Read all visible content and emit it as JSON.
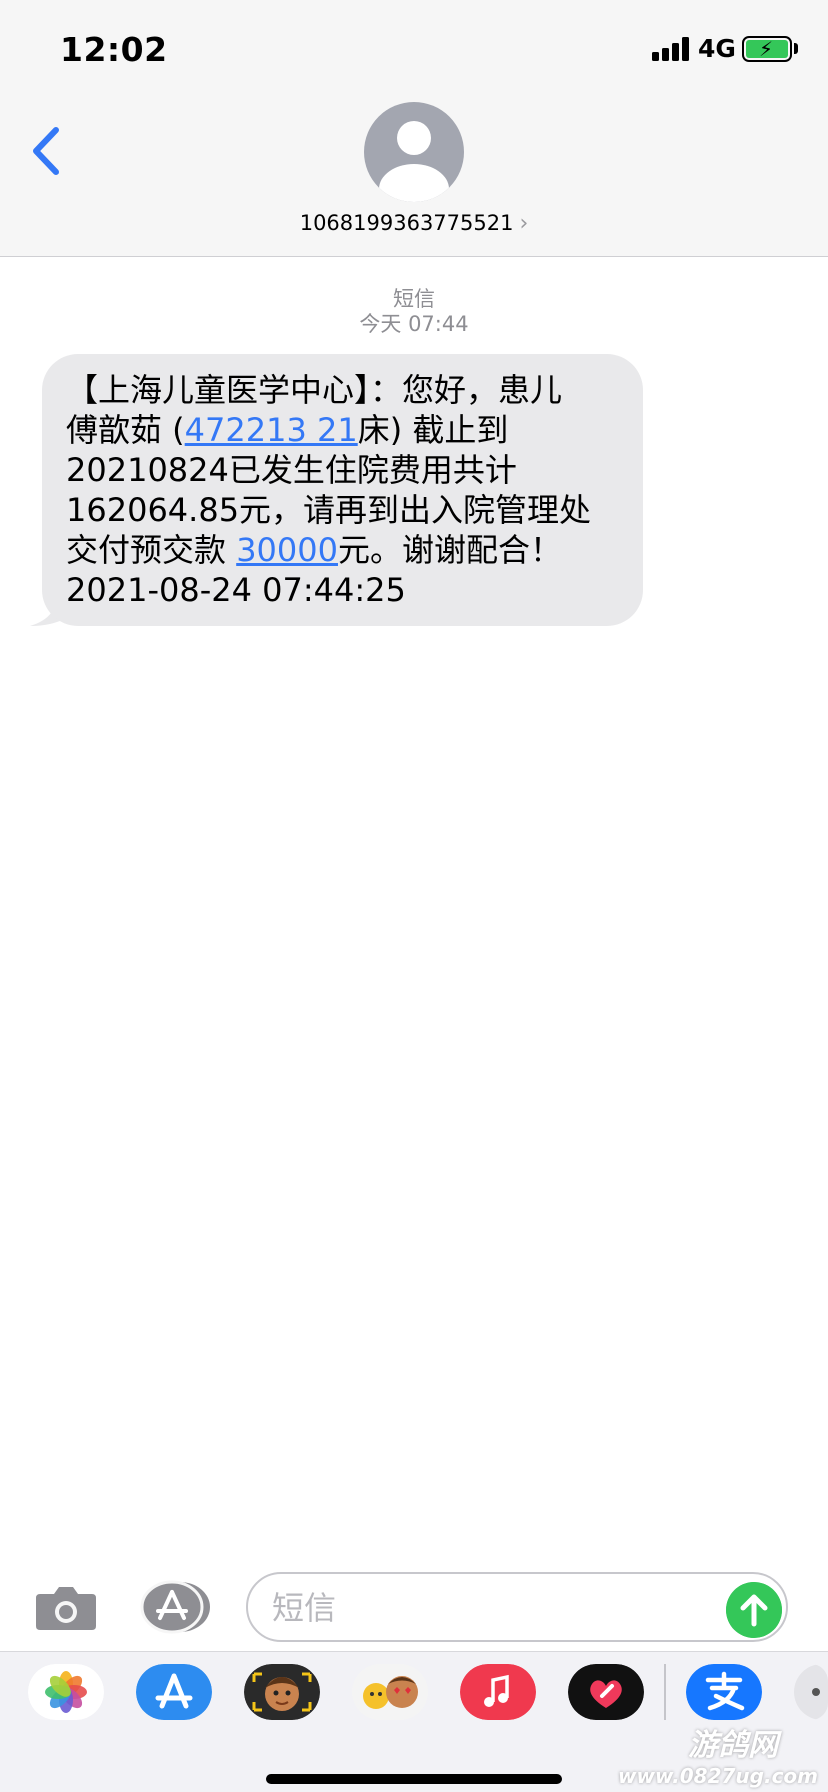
{
  "status_bar": {
    "time": "12:02",
    "network": "4G",
    "battery_charging": true
  },
  "header": {
    "contact_number": "1068199363775521",
    "chevron": "›"
  },
  "meta": {
    "service": "短信",
    "timestamp": "今天 07:44"
  },
  "message": {
    "line1": "【上海儿童医学中心】：您好，患儿",
    "line2_prefix": "傅歆茹 (",
    "line2_link": "472213 21",
    "line2_suffix": "床) 截止到",
    "line3": "20210824已发生住院费用共计",
    "line4": "162064.85元，请再到出入院管理处",
    "line5_prefix": "交付预交款 ",
    "line5_link": "30000",
    "line5_suffix": "元。谢谢配合！",
    "line6": "2021-08-24 07:44:25"
  },
  "input": {
    "placeholder": "短信"
  },
  "dock": {
    "apps": [
      "photos-app",
      "app-store-app",
      "memoji-app",
      "animoji-app",
      "music-app",
      "digital-touch-app",
      "alipay-app",
      "more-apps"
    ]
  },
  "watermark": {
    "name": "游鸽网",
    "url": "www.0827ug.com"
  },
  "colors": {
    "accent": "#3478f6",
    "send": "#34c759",
    "bubble": "#e9e9eb"
  }
}
